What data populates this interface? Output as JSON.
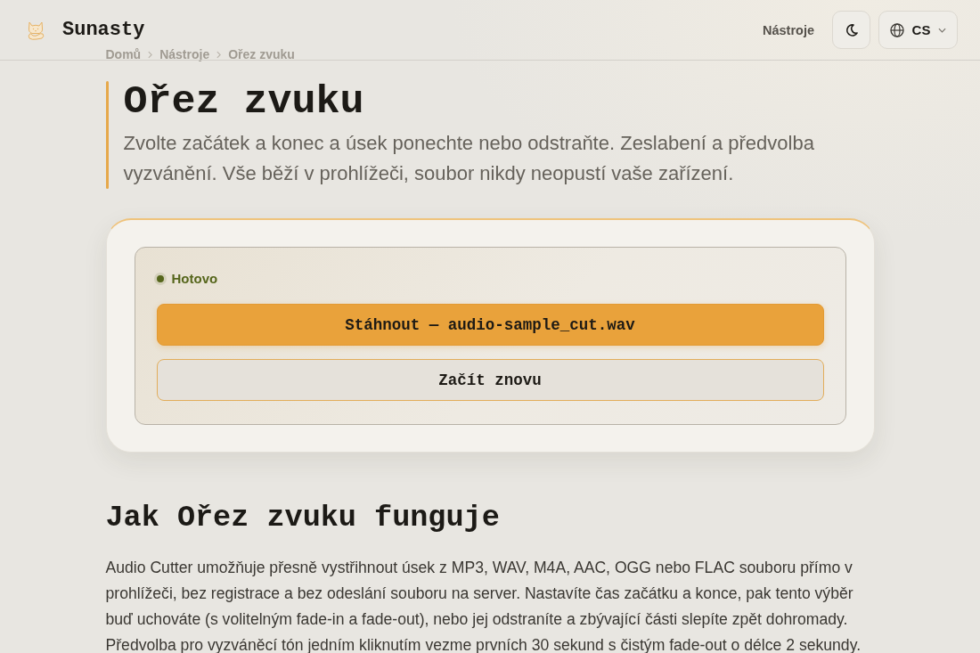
{
  "header": {
    "logo": "Sunasty",
    "nav": [
      {
        "label": "Nástroje"
      }
    ],
    "language": "CS"
  },
  "breadcrumb": [
    "Domů",
    "Nástroje",
    "Ořez zvuku"
  ],
  "hero": {
    "title": "Ořez zvuku",
    "subtitle": "Zvolte začátek a konec a úsek ponechte nebo odstraňte. Zeslabení a předvolba vyzvánění. Vše běží v prohlížeči, soubor nikdy neopustí vaše zařízení."
  },
  "result_panel": {
    "status": {
      "kind": "done",
      "label": "Hotovo"
    },
    "buttons": [
      {
        "kind": "primary",
        "label": "Stáhnout — audio-sample_cut.wav"
      },
      {
        "kind": "secondary",
        "label": "Začít znovu"
      }
    ]
  },
  "how_it_works": {
    "heading": "Jak Ořez zvuku funguje",
    "paragraph": "Audio Cutter umožňuje přesně vystřihnout úsek z MP3, WAV, M4A, AAC, OGG nebo FLAC souboru přímo v prohlížeči, bez registrace a bez odeslání souboru na server. Nastavíte čas začátku a konce, pak tento výběr buď uchováte (s volitelným fade-in a fade-out), nebo jej odstraníte a zbývající části slepíte zpět dohromady. Předvolba pro vyzváněcí tón jedním kliknutím vezme prvních 30 sekund s čistým fade-out o délce 2 sekundy."
  }
}
